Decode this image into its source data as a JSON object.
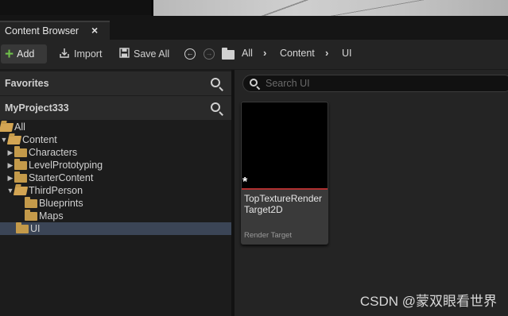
{
  "tab": {
    "title": "Content Browser",
    "close": "×"
  },
  "toolbar": {
    "add_label": "Add",
    "add_icon": "plus-icon",
    "import_label": "Import",
    "save_all_label": "Save All",
    "breadcrumb": [
      "All",
      "Content",
      "UI"
    ]
  },
  "left": {
    "favorites_label": "Favorites",
    "project_label": "MyProject333",
    "tree": [
      {
        "label": "All",
        "depth": 0,
        "arrow": "",
        "open": true
      },
      {
        "label": "Content",
        "depth": 0,
        "arrow": "▼",
        "open": true
      },
      {
        "label": "Characters",
        "depth": 1,
        "arrow": "▶",
        "open": false
      },
      {
        "label": "LevelPrototyping",
        "depth": 1,
        "arrow": "▶",
        "open": false
      },
      {
        "label": "StarterContent",
        "depth": 1,
        "arrow": "▶",
        "open": false
      },
      {
        "label": "ThirdPerson",
        "depth": 1,
        "arrow": "▼",
        "open": true
      },
      {
        "label": "Blueprints",
        "depth": 2,
        "arrow": "",
        "open": false
      },
      {
        "label": "Maps",
        "depth": 2,
        "arrow": "",
        "open": false
      },
      {
        "label": "UI",
        "depth": 1,
        "arrow": "",
        "open": false,
        "selected": true
      }
    ]
  },
  "right": {
    "search_placeholder": "Search UI",
    "asset": {
      "name": "TopTextureRender Target2D",
      "type": "Render Target",
      "marker": "*"
    }
  },
  "watermark": "CSDN @蒙双眼看世界",
  "colors": {
    "accent_green": "#6fbf4a",
    "folder": "#c49a4a",
    "selection": "#3b4556",
    "asset_line": "#b03030"
  }
}
